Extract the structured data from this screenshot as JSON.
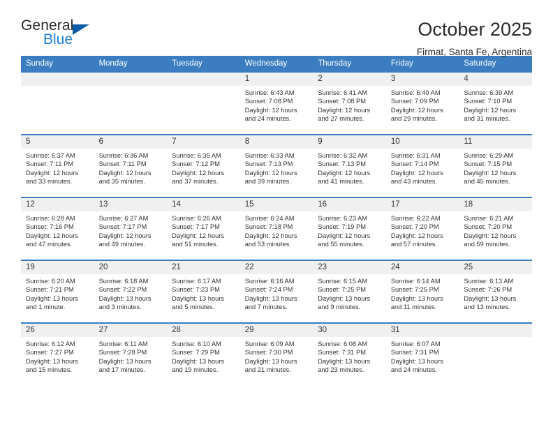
{
  "brand": {
    "name_top": "General",
    "name_bottom": "Blue",
    "accent_color": "#1f7fd0",
    "triangle_color": "#0a5ca8"
  },
  "header": {
    "title": "October 2025",
    "subtitle": "Firmat, Santa Fe, Argentina"
  },
  "calendar": {
    "header_bg": "#3b7dc0",
    "daynum_bg": "#f0f0f0",
    "weekdays": [
      "Sunday",
      "Monday",
      "Tuesday",
      "Wednesday",
      "Thursday",
      "Friday",
      "Saturday"
    ],
    "weeks": [
      [
        {
          "day": "",
          "sunrise": "",
          "sunset": "",
          "daylight_1": "",
          "daylight_2": "",
          "empty": true
        },
        {
          "day": "",
          "sunrise": "",
          "sunset": "",
          "daylight_1": "",
          "daylight_2": "",
          "empty": true
        },
        {
          "day": "",
          "sunrise": "",
          "sunset": "",
          "daylight_1": "",
          "daylight_2": "",
          "empty": true
        },
        {
          "day": "1",
          "sunrise": "Sunrise: 6:43 AM",
          "sunset": "Sunset: 7:08 PM",
          "daylight_1": "Daylight: 12 hours",
          "daylight_2": "and 24 minutes."
        },
        {
          "day": "2",
          "sunrise": "Sunrise: 6:41 AM",
          "sunset": "Sunset: 7:08 PM",
          "daylight_1": "Daylight: 12 hours",
          "daylight_2": "and 27 minutes."
        },
        {
          "day": "3",
          "sunrise": "Sunrise: 6:40 AM",
          "sunset": "Sunset: 7:09 PM",
          "daylight_1": "Daylight: 12 hours",
          "daylight_2": "and 29 minutes."
        },
        {
          "day": "4",
          "sunrise": "Sunrise: 6:39 AM",
          "sunset": "Sunset: 7:10 PM",
          "daylight_1": "Daylight: 12 hours",
          "daylight_2": "and 31 minutes."
        }
      ],
      [
        {
          "day": "5",
          "sunrise": "Sunrise: 6:37 AM",
          "sunset": "Sunset: 7:11 PM",
          "daylight_1": "Daylight: 12 hours",
          "daylight_2": "and 33 minutes."
        },
        {
          "day": "6",
          "sunrise": "Sunrise: 6:36 AM",
          "sunset": "Sunset: 7:11 PM",
          "daylight_1": "Daylight: 12 hours",
          "daylight_2": "and 35 minutes."
        },
        {
          "day": "7",
          "sunrise": "Sunrise: 6:35 AM",
          "sunset": "Sunset: 7:12 PM",
          "daylight_1": "Daylight: 12 hours",
          "daylight_2": "and 37 minutes."
        },
        {
          "day": "8",
          "sunrise": "Sunrise: 6:33 AM",
          "sunset": "Sunset: 7:13 PM",
          "daylight_1": "Daylight: 12 hours",
          "daylight_2": "and 39 minutes."
        },
        {
          "day": "9",
          "sunrise": "Sunrise: 6:32 AM",
          "sunset": "Sunset: 7:13 PM",
          "daylight_1": "Daylight: 12 hours",
          "daylight_2": "and 41 minutes."
        },
        {
          "day": "10",
          "sunrise": "Sunrise: 6:31 AM",
          "sunset": "Sunset: 7:14 PM",
          "daylight_1": "Daylight: 12 hours",
          "daylight_2": "and 43 minutes."
        },
        {
          "day": "11",
          "sunrise": "Sunrise: 6:29 AM",
          "sunset": "Sunset: 7:15 PM",
          "daylight_1": "Daylight: 12 hours",
          "daylight_2": "and 45 minutes."
        }
      ],
      [
        {
          "day": "12",
          "sunrise": "Sunrise: 6:28 AM",
          "sunset": "Sunset: 7:16 PM",
          "daylight_1": "Daylight: 12 hours",
          "daylight_2": "and 47 minutes."
        },
        {
          "day": "13",
          "sunrise": "Sunrise: 6:27 AM",
          "sunset": "Sunset: 7:17 PM",
          "daylight_1": "Daylight: 12 hours",
          "daylight_2": "and 49 minutes."
        },
        {
          "day": "14",
          "sunrise": "Sunrise: 6:26 AM",
          "sunset": "Sunset: 7:17 PM",
          "daylight_1": "Daylight: 12 hours",
          "daylight_2": "and 51 minutes."
        },
        {
          "day": "15",
          "sunrise": "Sunrise: 6:24 AM",
          "sunset": "Sunset: 7:18 PM",
          "daylight_1": "Daylight: 12 hours",
          "daylight_2": "and 53 minutes."
        },
        {
          "day": "16",
          "sunrise": "Sunrise: 6:23 AM",
          "sunset": "Sunset: 7:19 PM",
          "daylight_1": "Daylight: 12 hours",
          "daylight_2": "and 55 minutes."
        },
        {
          "day": "17",
          "sunrise": "Sunrise: 6:22 AM",
          "sunset": "Sunset: 7:20 PM",
          "daylight_1": "Daylight: 12 hours",
          "daylight_2": "and 57 minutes."
        },
        {
          "day": "18",
          "sunrise": "Sunrise: 6:21 AM",
          "sunset": "Sunset: 7:20 PM",
          "daylight_1": "Daylight: 12 hours",
          "daylight_2": "and 59 minutes."
        }
      ],
      [
        {
          "day": "19",
          "sunrise": "Sunrise: 6:20 AM",
          "sunset": "Sunset: 7:21 PM",
          "daylight_1": "Daylight: 13 hours",
          "daylight_2": "and 1 minute."
        },
        {
          "day": "20",
          "sunrise": "Sunrise: 6:18 AM",
          "sunset": "Sunset: 7:22 PM",
          "daylight_1": "Daylight: 13 hours",
          "daylight_2": "and 3 minutes."
        },
        {
          "day": "21",
          "sunrise": "Sunrise: 6:17 AM",
          "sunset": "Sunset: 7:23 PM",
          "daylight_1": "Daylight: 13 hours",
          "daylight_2": "and 5 minutes."
        },
        {
          "day": "22",
          "sunrise": "Sunrise: 6:16 AM",
          "sunset": "Sunset: 7:24 PM",
          "daylight_1": "Daylight: 13 hours",
          "daylight_2": "and 7 minutes."
        },
        {
          "day": "23",
          "sunrise": "Sunrise: 6:15 AM",
          "sunset": "Sunset: 7:25 PM",
          "daylight_1": "Daylight: 13 hours",
          "daylight_2": "and 9 minutes."
        },
        {
          "day": "24",
          "sunrise": "Sunrise: 6:14 AM",
          "sunset": "Sunset: 7:25 PM",
          "daylight_1": "Daylight: 13 hours",
          "daylight_2": "and 11 minutes."
        },
        {
          "day": "25",
          "sunrise": "Sunrise: 6:13 AM",
          "sunset": "Sunset: 7:26 PM",
          "daylight_1": "Daylight: 13 hours",
          "daylight_2": "and 13 minutes."
        }
      ],
      [
        {
          "day": "26",
          "sunrise": "Sunrise: 6:12 AM",
          "sunset": "Sunset: 7:27 PM",
          "daylight_1": "Daylight: 13 hours",
          "daylight_2": "and 15 minutes."
        },
        {
          "day": "27",
          "sunrise": "Sunrise: 6:11 AM",
          "sunset": "Sunset: 7:28 PM",
          "daylight_1": "Daylight: 13 hours",
          "daylight_2": "and 17 minutes."
        },
        {
          "day": "28",
          "sunrise": "Sunrise: 6:10 AM",
          "sunset": "Sunset: 7:29 PM",
          "daylight_1": "Daylight: 13 hours",
          "daylight_2": "and 19 minutes."
        },
        {
          "day": "29",
          "sunrise": "Sunrise: 6:09 AM",
          "sunset": "Sunset: 7:30 PM",
          "daylight_1": "Daylight: 13 hours",
          "daylight_2": "and 21 minutes."
        },
        {
          "day": "30",
          "sunrise": "Sunrise: 6:08 AM",
          "sunset": "Sunset: 7:31 PM",
          "daylight_1": "Daylight: 13 hours",
          "daylight_2": "and 23 minutes."
        },
        {
          "day": "31",
          "sunrise": "Sunrise: 6:07 AM",
          "sunset": "Sunset: 7:31 PM",
          "daylight_1": "Daylight: 13 hours",
          "daylight_2": "and 24 minutes."
        },
        {
          "day": "",
          "sunrise": "",
          "sunset": "",
          "daylight_1": "",
          "daylight_2": "",
          "empty": true
        }
      ]
    ]
  }
}
